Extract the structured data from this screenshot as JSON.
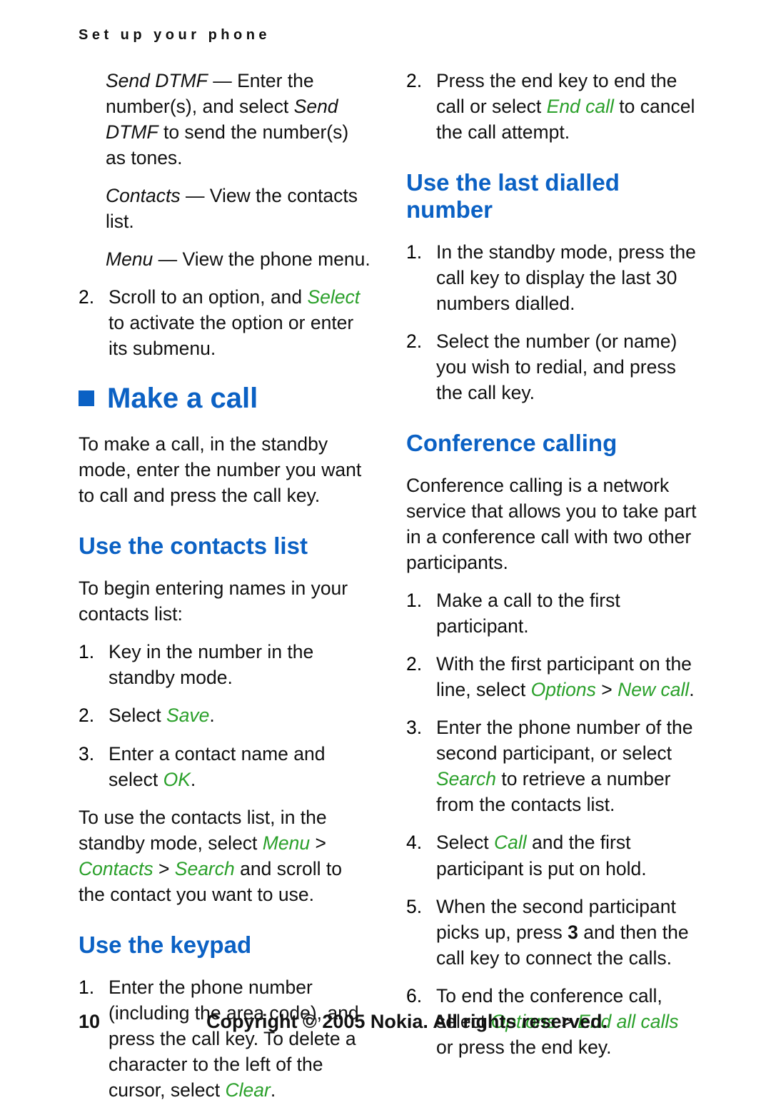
{
  "header": {
    "running_head": "Set up your phone"
  },
  "left_column": {
    "blocks": [
      {
        "type": "indent_para",
        "runs": [
          {
            "text": "Send DTMF",
            "style": "italic"
          },
          {
            "text": " — Enter the number(s), and select ",
            "style": "plain"
          },
          {
            "text": "Send DTMF",
            "style": "italic"
          },
          {
            "text": " to send the number(s) as tones.",
            "style": "plain"
          }
        ]
      },
      {
        "type": "indent_para",
        "runs": [
          {
            "text": "Contacts",
            "style": "italic"
          },
          {
            "text": " — View the contacts list.",
            "style": "plain"
          }
        ]
      },
      {
        "type": "indent_para",
        "runs": [
          {
            "text": "Menu",
            "style": "italic"
          },
          {
            "text": " — View the phone menu.",
            "style": "plain"
          }
        ]
      },
      {
        "type": "numbered",
        "number": "2.",
        "runs": [
          {
            "text": "Scroll to an option, and ",
            "style": "plain"
          },
          {
            "text": "Select",
            "style": "green-italic"
          },
          {
            "text": " to activate the option or enter its submenu.",
            "style": "plain"
          }
        ]
      },
      {
        "type": "h1",
        "text": "Make a call"
      },
      {
        "type": "para",
        "runs": [
          {
            "text": "To make a call, in the standby mode, enter the number you want to call and press the call key.",
            "style": "plain"
          }
        ]
      },
      {
        "type": "h2",
        "text": "Use the contacts list"
      },
      {
        "type": "para",
        "runs": [
          {
            "text": "To begin entering names in your contacts list:",
            "style": "plain"
          }
        ]
      },
      {
        "type": "numbered",
        "number": "1.",
        "runs": [
          {
            "text": "Key in the number in the standby mode.",
            "style": "plain"
          }
        ]
      },
      {
        "type": "numbered",
        "number": "2.",
        "runs": [
          {
            "text": "Select ",
            "style": "plain"
          },
          {
            "text": "Save",
            "style": "green-italic"
          },
          {
            "text": ".",
            "style": "plain"
          }
        ]
      },
      {
        "type": "numbered",
        "number": "3.",
        "runs": [
          {
            "text": "Enter a contact name and select ",
            "style": "plain"
          },
          {
            "text": "OK",
            "style": "green-italic"
          },
          {
            "text": ".",
            "style": "plain"
          }
        ]
      },
      {
        "type": "para",
        "runs": [
          {
            "text": "To use the contacts list, in the standby mode, select ",
            "style": "plain"
          },
          {
            "text": "Menu",
            "style": "green-italic"
          },
          {
            "text": " > ",
            "style": "plain"
          },
          {
            "text": "Contacts",
            "style": "green-italic"
          },
          {
            "text": " > ",
            "style": "plain"
          },
          {
            "text": "Search",
            "style": "green-italic"
          },
          {
            "text": " and scroll to the contact you want to use.",
            "style": "plain"
          }
        ]
      },
      {
        "type": "h2",
        "text": "Use the keypad"
      },
      {
        "type": "numbered",
        "number": "1.",
        "runs": [
          {
            "text": "Enter the phone number (including the area code), and press the call key. To delete a character to the left of the cursor, select ",
            "style": "plain"
          },
          {
            "text": "Clear",
            "style": "green-italic"
          },
          {
            "text": ".",
            "style": "plain"
          }
        ]
      }
    ]
  },
  "right_column": {
    "blocks": [
      {
        "type": "numbered",
        "number": "2.",
        "runs": [
          {
            "text": "Press the end key to end the call or select ",
            "style": "plain"
          },
          {
            "text": "End call",
            "style": "green-italic"
          },
          {
            "text": " to cancel the call attempt.",
            "style": "plain"
          }
        ]
      },
      {
        "type": "h2",
        "text": "Use the last dialled number"
      },
      {
        "type": "numbered",
        "number": "1.",
        "runs": [
          {
            "text": "In the standby mode, press the call key to display the last 30 numbers dialled.",
            "style": "plain"
          }
        ]
      },
      {
        "type": "numbered",
        "number": "2.",
        "runs": [
          {
            "text": "Select the number (or name) you wish to redial, and press the call key.",
            "style": "plain"
          }
        ]
      },
      {
        "type": "h2",
        "text": "Conference calling"
      },
      {
        "type": "para",
        "runs": [
          {
            "text": "Conference calling is a network service that allows you to take part in a conference call with two other participants.",
            "style": "plain"
          }
        ]
      },
      {
        "type": "numbered",
        "number": "1.",
        "runs": [
          {
            "text": "Make a call to the first participant.",
            "style": "plain"
          }
        ]
      },
      {
        "type": "numbered",
        "number": "2.",
        "runs": [
          {
            "text": "With the first participant on the line, select ",
            "style": "plain"
          },
          {
            "text": "Options",
            "style": "green-italic"
          },
          {
            "text": " > ",
            "style": "plain"
          },
          {
            "text": "New call",
            "style": "green-italic"
          },
          {
            "text": ".",
            "style": "plain"
          }
        ]
      },
      {
        "type": "numbered",
        "number": "3.",
        "runs": [
          {
            "text": "Enter the phone number of the second participant, or select ",
            "style": "plain"
          },
          {
            "text": "Search",
            "style": "green-italic"
          },
          {
            "text": " to retrieve a number from the contacts list.",
            "style": "plain"
          }
        ]
      },
      {
        "type": "numbered",
        "number": "4.",
        "runs": [
          {
            "text": "Select ",
            "style": "plain"
          },
          {
            "text": "Call",
            "style": "green-italic"
          },
          {
            "text": " and the first participant is put on hold.",
            "style": "plain"
          }
        ]
      },
      {
        "type": "numbered",
        "number": "5.",
        "runs": [
          {
            "text": "When the second participant picks up, press ",
            "style": "plain"
          },
          {
            "text": "3",
            "style": "bold"
          },
          {
            "text": " and then the call key to connect the calls.",
            "style": "plain"
          }
        ]
      },
      {
        "type": "numbered",
        "number": "6.",
        "runs": [
          {
            "text": "To end the conference call, select ",
            "style": "plain"
          },
          {
            "text": "Options",
            "style": "green-italic"
          },
          {
            "text": " > ",
            "style": "plain"
          },
          {
            "text": "End all calls",
            "style": "green-italic"
          },
          {
            "text": " or press the end key.",
            "style": "plain"
          }
        ]
      }
    ]
  },
  "footer": {
    "page_number": "10",
    "copyright": "Copyright © 2005 Nokia. All rights reserved."
  },
  "colors": {
    "heading_blue": "#0b61c4",
    "ui_term_green": "#2aa02a",
    "body_text": "#111111"
  }
}
